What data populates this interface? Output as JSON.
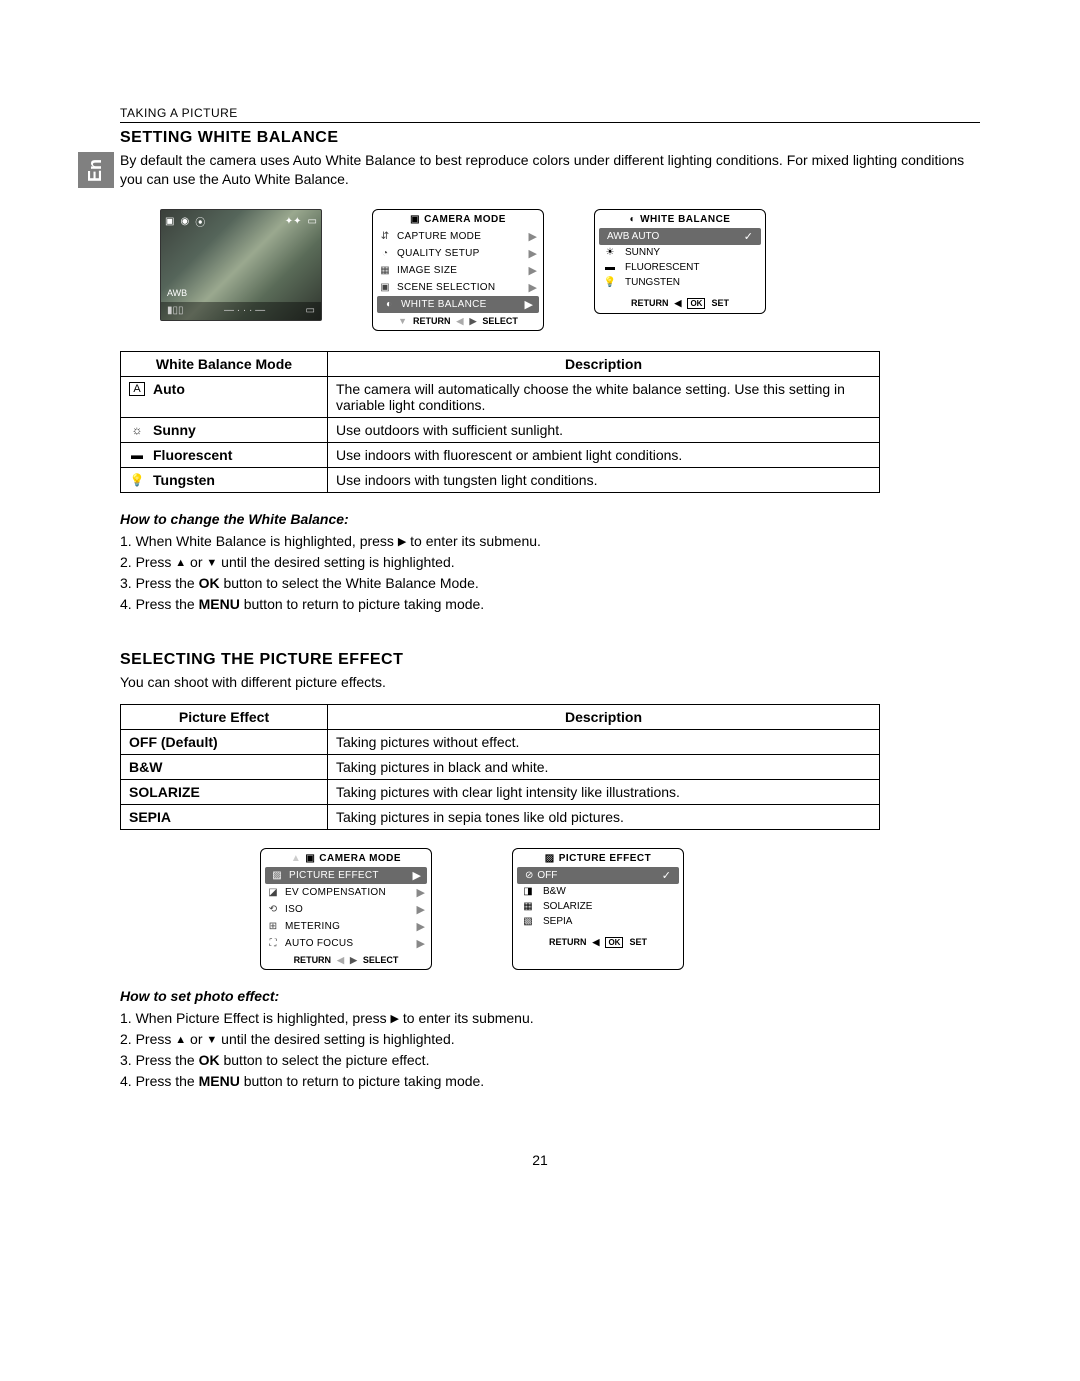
{
  "breadcrumb": "TAKING A PICTURE",
  "lang_label": "En",
  "section1": {
    "title": "SETTING WHITE BALANCE",
    "intro": "By default the camera uses Auto White Balance to best reproduce colors under different lighting conditions. For mixed lighting conditions you can use the Auto White Balance."
  },
  "photo_labels": {
    "awb": "AWB"
  },
  "camera_menu": {
    "title": "CAMERA MODE",
    "items": [
      {
        "label": "CAPTURE MODE"
      },
      {
        "label": "QUALITY SETUP"
      },
      {
        "label": "IMAGE SIZE"
      },
      {
        "label": "SCENE SELECTION"
      },
      {
        "label": "WHITE BALANCE",
        "highlight": true
      }
    ],
    "footer_return": "RETURN",
    "footer_select": "SELECT"
  },
  "wb_menu": {
    "title": "WHITE BALANCE",
    "items": [
      {
        "label": "AUTO",
        "prefix": "AWB",
        "highlight": true
      },
      {
        "label": "SUNNY",
        "icon": "☀"
      },
      {
        "label": "FLUORESCENT",
        "icon": "▬"
      },
      {
        "label": "TUNGSTEN",
        "icon": "💡"
      }
    ],
    "footer_return": "RETURN",
    "footer_set": "SET"
  },
  "wb_table": {
    "h1": "White Balance Mode",
    "h2": "Description",
    "rows": [
      {
        "mode": "Auto",
        "icon": "A",
        "boxed": true,
        "desc": "The camera will automatically choose the white balance setting. Use this setting in variable light conditions."
      },
      {
        "mode": "Sunny",
        "icon": "☼",
        "desc": "Use outdoors with sufficient sunlight."
      },
      {
        "mode": "Fluorescent",
        "icon": "▬",
        "desc": "Use indoors with fluorescent or ambient light conditions."
      },
      {
        "mode": "Tungsten",
        "icon": "💡",
        "desc": "Use indoors with tungsten light conditions."
      }
    ]
  },
  "howto_wb": {
    "title": "How to change the White Balance:",
    "s1_a": "1. When White Balance is highlighted, press ",
    "s1_b": " to enter its submenu.",
    "s2_a": "2. Press ",
    "s2_b": " or ",
    "s2_c": "  until the desired setting is highlighted.",
    "s3_a": "3. Press the ",
    "s3_ok": "OK",
    "s3_b": " button to select the White Balance Mode.",
    "s4_a": "4. Press the ",
    "s4_menu": "MENU",
    "s4_b": " button to return to picture taking mode."
  },
  "section2": {
    "title": "SELECTING THE PICTURE EFFECT",
    "intro": "You can shoot with different picture effects."
  },
  "pe_table": {
    "h1": "Picture Effect",
    "h2": "Description",
    "rows": [
      {
        "mode": "OFF  (Default)",
        "desc": "Taking pictures without effect."
      },
      {
        "mode": "B&W",
        "desc": "Taking pictures in black and white."
      },
      {
        "mode": "SOLARIZE",
        "desc": "Taking pictures with clear light intensity like illustrations."
      },
      {
        "mode": "SEPIA",
        "desc": "Taking pictures in sepia tones like old pictures."
      }
    ]
  },
  "camera_menu2": {
    "title": "CAMERA MODE",
    "items": [
      {
        "label": "PICTURE EFFECT",
        "highlight": true
      },
      {
        "label": "EV COMPENSATION"
      },
      {
        "label": "ISO"
      },
      {
        "label": "METERING"
      },
      {
        "label": "AUTO FOCUS"
      }
    ],
    "footer_return": "RETURN",
    "footer_select": "SELECT"
  },
  "pe_menu": {
    "title": "PICTURE EFFECT",
    "items": [
      {
        "label": "OFF",
        "highlight": true
      },
      {
        "label": "B&W"
      },
      {
        "label": "SOLARIZE"
      },
      {
        "label": "SEPIA"
      }
    ],
    "footer_return": "RETURN",
    "footer_set": "SET"
  },
  "howto_pe": {
    "title": "How to set photo effect:",
    "s1_a": "1.  When Picture Effect is highlighted, press ",
    "s1_b": "  to enter its submenu.",
    "s2_a": "2.  Press ",
    "s2_b": "  or ",
    "s2_c": "  until the desired setting is highlighted.",
    "s3_a": "3.  Press the ",
    "s3_ok": "OK",
    "s3_b": " button to select the picture effect.",
    "s4_a": "4.  Press the ",
    "s4_menu": "MENU",
    "s4_b": " button to return to picture taking mode."
  },
  "page_number": "21"
}
